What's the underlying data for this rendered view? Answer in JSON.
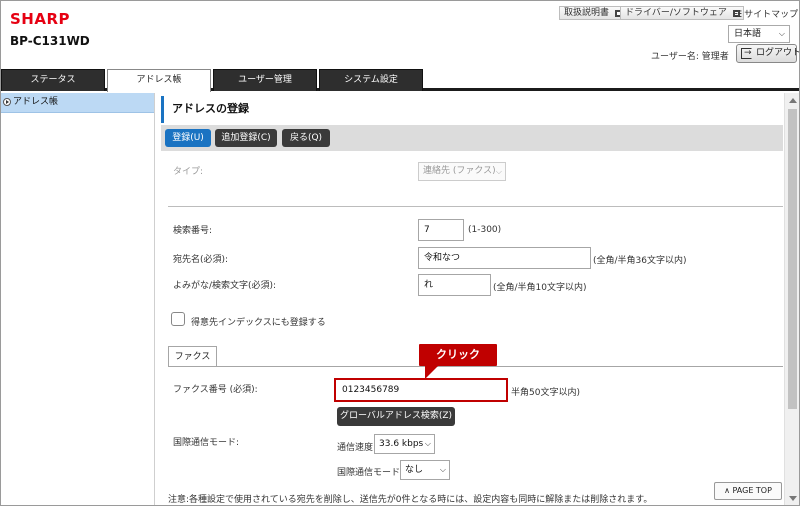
{
  "header": {
    "brand": "SHARP",
    "model": "BP-C131WD",
    "links": {
      "manual": "取扱説明書",
      "driver": "ドライバー/ソフトウェア",
      "sitemap": "サイトマップ"
    },
    "language": "日本語",
    "user_label": "ユーザー名: 管理者",
    "logout": "ログアウト"
  },
  "tabs": [
    {
      "label": "ステータス",
      "active": false
    },
    {
      "label": "アドレス帳",
      "active": true
    },
    {
      "label": "ユーザー管理",
      "active": false
    },
    {
      "label": "システム設定",
      "active": false
    }
  ],
  "sidebar": {
    "items": [
      {
        "label": "アドレス帳",
        "selected": true
      }
    ]
  },
  "page": {
    "title": "アドレスの登録",
    "actions": {
      "register": "登録(U)",
      "add": "追加登録(C)",
      "back": "戻る(Q)"
    }
  },
  "form": {
    "type": {
      "label": "タイプ:",
      "value": "連絡先 (ファクス)"
    },
    "search_no": {
      "label": "検索番号:",
      "value": "7",
      "hint": "(1-300)"
    },
    "name": {
      "label": "宛先名(必須):",
      "value": "令和なつ",
      "hint": "(全角/半角36文字以内)"
    },
    "kana": {
      "label": "よみがな/検索文字(必須):",
      "value": "れ",
      "hint": "(全角/半角10文字以内)"
    },
    "favorite": {
      "label": "得意先インデックスにも登録する",
      "checked": false
    },
    "subtab": "ファクス",
    "fax_no": {
      "label": "ファクス番号 (必須):",
      "value": "0123456789",
      "hint": "半角50文字以内)"
    },
    "global_search": "グローバルアドレス検索(Z)",
    "intl_mode": {
      "label": "国際通信モード:"
    },
    "speed": {
      "label": "通信速度:",
      "value": "33.6 kbps"
    },
    "intl": {
      "label": "国際通信モード:",
      "value": "なし"
    }
  },
  "callout": {
    "text": "クリック"
  },
  "note": "注意:各種設定で使用されている宛先を削除し、送信先が0件となる時には、設定内容も同時に解除または削除されます。",
  "page_top": "PAGE TOP",
  "colors": {
    "brand": "#e60012",
    "accent": "#1a73c2",
    "highlight": "#c00000"
  }
}
